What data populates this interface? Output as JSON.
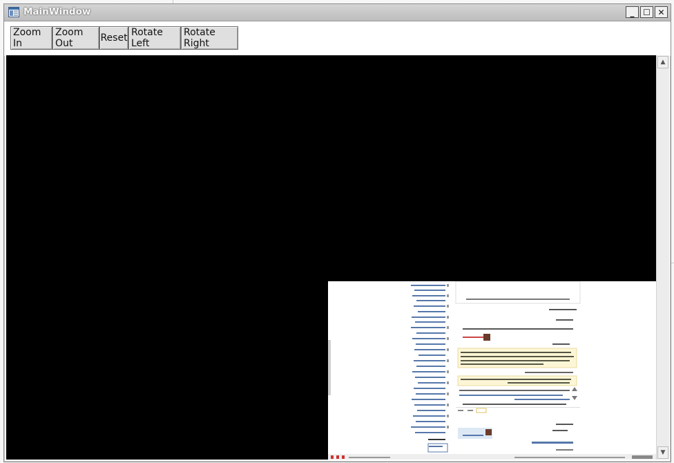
{
  "window": {
    "title": "MainWindow",
    "controls": {
      "minimize": "_",
      "maximize": "☐",
      "close": "✕"
    }
  },
  "toolbar": {
    "zoom_in": "Zoom In",
    "zoom_out": "Zoom Out",
    "reset": "Reset",
    "rotate_left": "Rotate Left",
    "rotate_right": "Rotate Right"
  },
  "scrollbar": {
    "up": "▲",
    "down": "▼"
  },
  "colors": {
    "viewport_bg": "#000000",
    "titlebar": "#c8c8c8",
    "button_face": "#dfdfdf"
  },
  "image": {
    "rotation": "upside-down",
    "content": "web-page-screenshot"
  }
}
